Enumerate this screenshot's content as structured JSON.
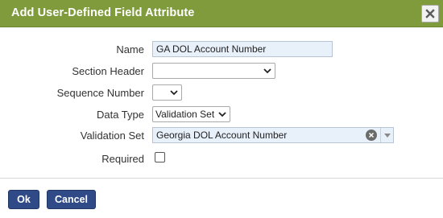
{
  "dialog": {
    "title": "Add User-Defined Field Attribute",
    "close_icon": "close-icon"
  },
  "form": {
    "name": {
      "label": "Name",
      "value": "GA DOL Account Number"
    },
    "section_header": {
      "label": "Section Header",
      "value": ""
    },
    "sequence_number": {
      "label": "Sequence Number",
      "value": ""
    },
    "data_type": {
      "label": "Data Type",
      "value": "Validation Set"
    },
    "validation_set": {
      "label": "Validation Set",
      "value": "Georgia DOL Account Number"
    },
    "required": {
      "label": "Required",
      "checked": false
    }
  },
  "buttons": {
    "ok": "Ok",
    "cancel": "Cancel"
  },
  "colors": {
    "titlebar": "#7f9b3c",
    "primary_button": "#2f4a87",
    "field_fill": "#e8f0fa"
  }
}
